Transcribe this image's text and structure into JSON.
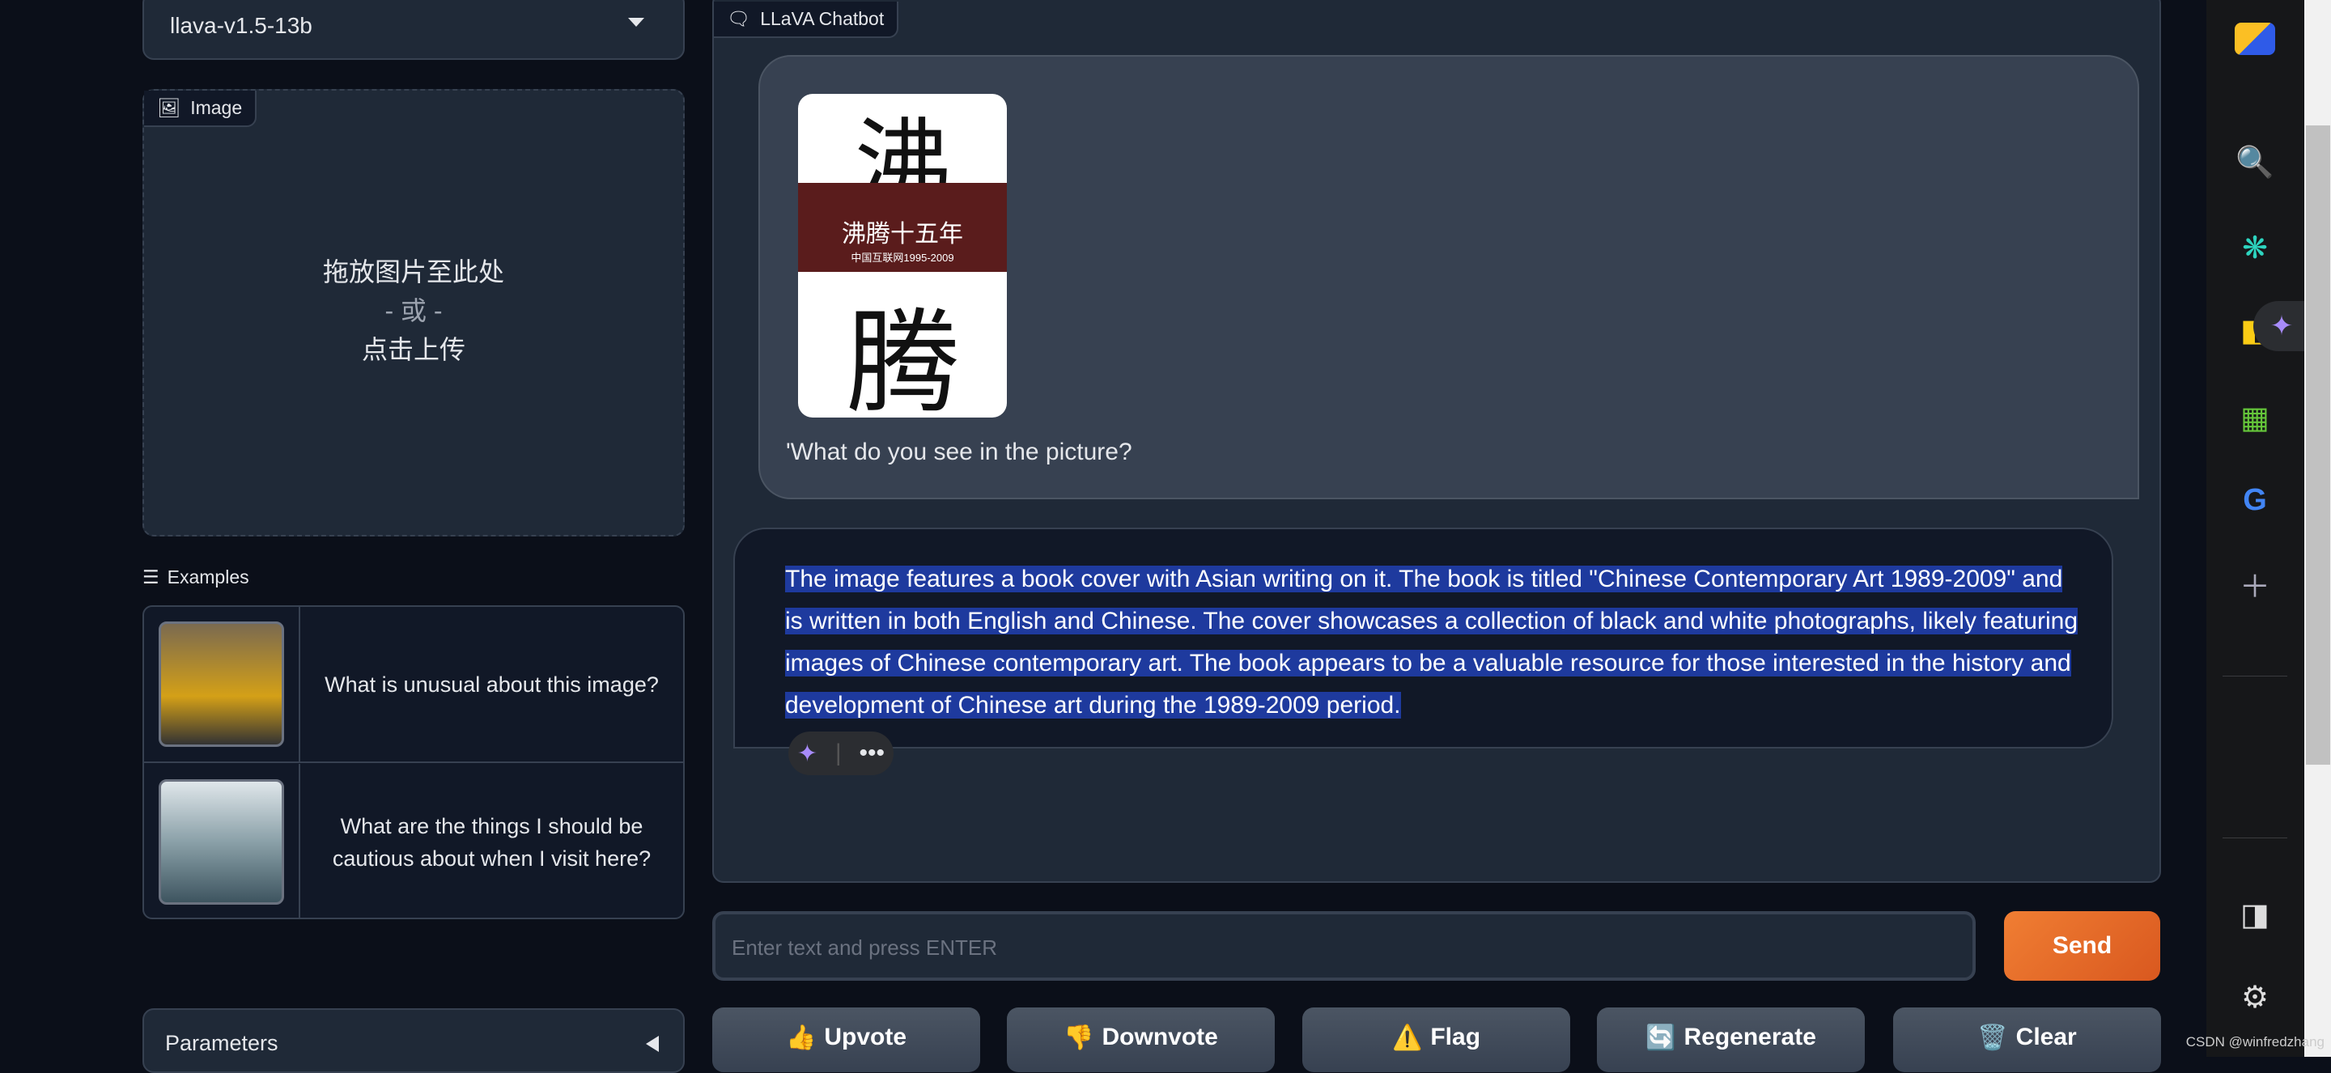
{
  "model_select": {
    "value": "llava-v1.5-13b"
  },
  "image_upload": {
    "label": "Image",
    "drop_text": "拖放图片至此处",
    "or_text": "- 或 -",
    "click_text": "点击上传"
  },
  "examples": {
    "label": "Examples",
    "items": [
      {
        "text": "What is unusual about this image?"
      },
      {
        "text": "What are the things I should be cautious about when I visit here?"
      }
    ]
  },
  "parameters": {
    "label": "Parameters"
  },
  "chatbot": {
    "label": "LLaVA Chatbot",
    "messages": [
      {
        "role": "user",
        "image_title": "沸腾十五年",
        "image_subtitle": "中国互联网1995-2009",
        "text": "'What do you see in the picture?"
      },
      {
        "role": "assistant",
        "text": "The image features a book cover with Asian writing on it. The book is titled \"Chinese Contemporary Art 1989-2009\" and is written in both English and Chinese. The cover showcases a collection of black and white photographs, likely featuring images of Chinese contemporary art. The book appears to be a valuable resource for those interested in the history and development of Chinese art during the 1989-2009 period."
      }
    ]
  },
  "input": {
    "placeholder": "Enter text and press ENTER",
    "send_label": "Send"
  },
  "actions": [
    {
      "label": "Upvote",
      "icon": "👍"
    },
    {
      "label": "Downvote",
      "icon": "👎"
    },
    {
      "label": "Flag",
      "icon": "⚠️"
    },
    {
      "label": "Regenerate",
      "icon": "🔄"
    },
    {
      "label": "Clear",
      "icon": "🗑️"
    }
  ],
  "watermark": "CSDN @winfredzhang",
  "colors": {
    "accent": "#e8702a",
    "selection": "#1e3a9e",
    "background": "#0b0f19"
  }
}
